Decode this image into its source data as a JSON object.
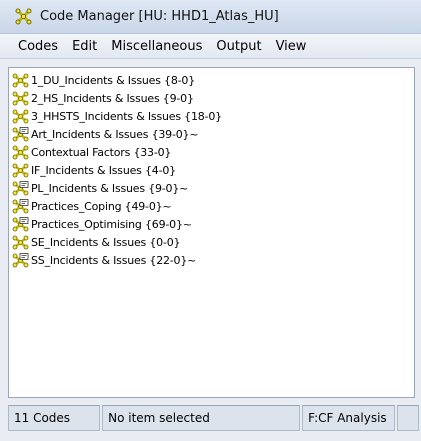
{
  "window": {
    "title": "Code Manager [HU: HHD1_Atlas_HU]",
    "title_icon": "code-manager-icon"
  },
  "menu": [
    "Codes",
    "Edit",
    "Miscellaneous",
    "Output",
    "View"
  ],
  "codes": [
    {
      "label": "1_DU_Incidents & Issues {8-0}",
      "icon": "code-icon"
    },
    {
      "label": "2_HS_Incidents & Issues {9-0}",
      "icon": "code-icon"
    },
    {
      "label": "3_HHSTS_Incidents & Issues {18-0}",
      "icon": "code-icon"
    },
    {
      "label": "Art_Incidents & Issues {39-0}~",
      "icon": "code-commented-icon"
    },
    {
      "label": "Contextual Factors {33-0}",
      "icon": "code-icon"
    },
    {
      "label": "IF_Incidents & Issues {4-0}",
      "icon": "code-icon"
    },
    {
      "label": "PL_Incidents & Issues {9-0}~",
      "icon": "code-commented-icon"
    },
    {
      "label": "Practices_Coping {49-0}~",
      "icon": "code-commented-icon"
    },
    {
      "label": "Practices_Optimising {69-0}~",
      "icon": "code-commented-icon"
    },
    {
      "label": "SE_Incidents & Issues {0-0}",
      "icon": "code-icon"
    },
    {
      "label": "SS_Incidents & Issues {22-0}~",
      "icon": "code-commented-icon"
    }
  ],
  "status": {
    "count": "11 Codes",
    "selection": "No item selected",
    "filter": "F:CF Analysis"
  }
}
